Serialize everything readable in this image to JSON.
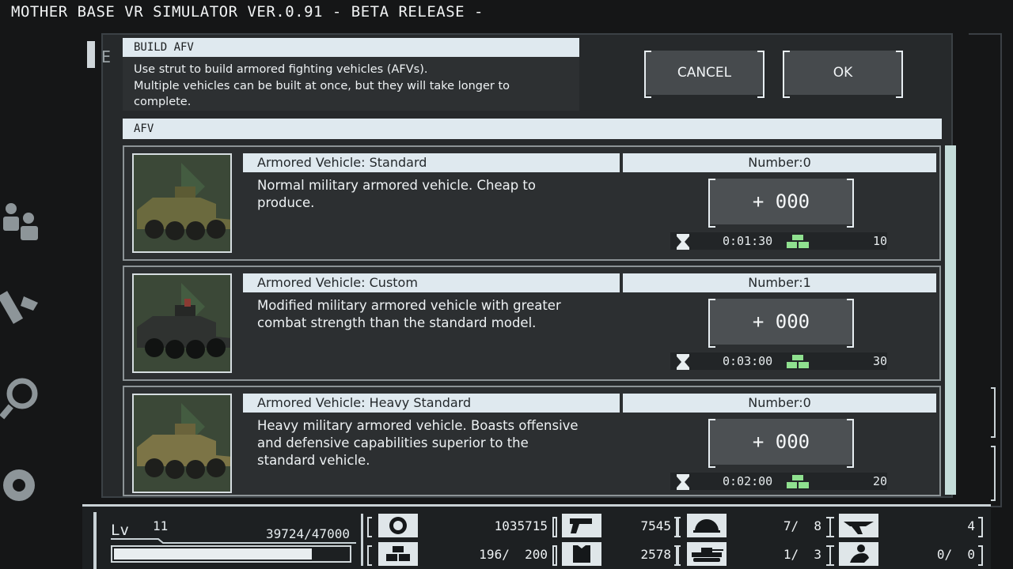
{
  "window_title": "MOTHER BASE VR SIMULATOR VER.0.91 - BETA RELEASE -",
  "panel_tab_letters": "E",
  "header": {
    "title": "BUILD AFV",
    "description_line1": "Use strut to build armored fighting vehicles (AFVs).",
    "description_line2": "Multiple vehicles can be built at once, but they will take longer to",
    "description_line3": "complete."
  },
  "buttons": {
    "cancel": "CANCEL",
    "ok": "OK"
  },
  "section_title": "AFV",
  "items": [
    {
      "name": "Armored Vehicle: Standard",
      "number": "Number:0",
      "description": "Normal military armored vehicle. Cheap to produce.",
      "quantity": "+ 000",
      "time": "0:01:30",
      "cost": "10",
      "vehicle_color": "#6b6a3e"
    },
    {
      "name": "Armored Vehicle: Custom",
      "number": "Number:1",
      "description_line1": "Modified military armored vehicle with greater",
      "description_line2": "combat strength than the standard model.",
      "quantity": "+ 000",
      "time": "0:03:00",
      "cost": "30",
      "vehicle_color": "#2f3230"
    },
    {
      "name": "Armored Vehicle: Heavy Standard",
      "number": "Number:0",
      "description_line1": "Heavy military armored vehicle. Boasts offensive",
      "description_line2": "and defensive capabilities superior to the",
      "description_line3": "standard vehicle.",
      "quantity": "+ 000",
      "time": "0:02:00",
      "cost": "20",
      "vehicle_color": "#7c7446"
    }
  ],
  "status": {
    "lv_label": "Lv",
    "lv_value": "11",
    "xp": "39724/47000",
    "xp_fraction": 0.845,
    "resources": [
      {
        "icon": "gmp-icon",
        "value": "1035715"
      },
      {
        "icon": "handgun-icon",
        "value": "7545"
      },
      {
        "icon": "helmet-icon",
        "value": "7/  8"
      },
      {
        "icon": "aircraft-icon",
        "value": "4"
      },
      {
        "icon": "strut-icon",
        "value": "196/  200"
      },
      {
        "icon": "body-armor-icon",
        "value": "2578"
      },
      {
        "icon": "tank-icon",
        "value": "1/  3"
      },
      {
        "icon": "staff-icon",
        "value": "0/  0"
      }
    ]
  },
  "colors": {
    "accent_bar": "#dfe9ef",
    "scrollbar": "#c4dcd9",
    "gold": "#8fe08f"
  }
}
